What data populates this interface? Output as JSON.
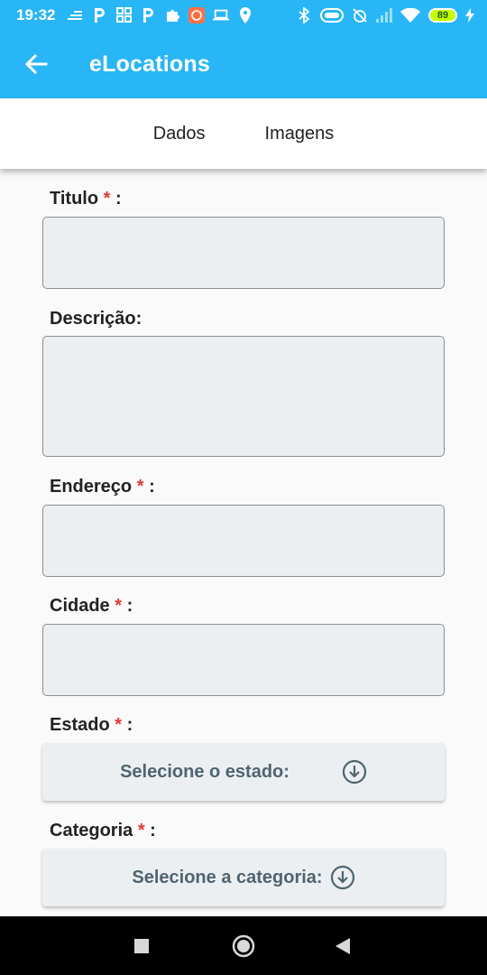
{
  "status_bar": {
    "time": "19:32",
    "battery_level": "89",
    "left_icons": [
      "data-traffic-icon",
      "parking-p-icon",
      "qr-grid-icon",
      "parking-p-icon",
      "puzzle-icon",
      "app-badge-icon",
      "laptop-icon",
      "location-pin-icon"
    ],
    "right_icons": [
      "bluetooth-icon",
      "toggle-icon",
      "alarm-off-icon",
      "signal-icon",
      "wifi-icon",
      "battery-icon",
      "charging-icon"
    ]
  },
  "app_bar": {
    "title": "eLocations",
    "back_icon": "arrow-left-icon",
    "color": "#29b6f6"
  },
  "tabs": [
    {
      "label": "Dados"
    },
    {
      "label": "Imagens"
    }
  ],
  "form": {
    "required_marker": "*",
    "separator": ":",
    "titulo": {
      "label": "Titulo",
      "required": true
    },
    "descricao": {
      "label": "Descrição:",
      "required": false
    },
    "endereco": {
      "label": "Endereço",
      "required": true
    },
    "cidade": {
      "label": "Cidade",
      "required": true
    },
    "estado": {
      "label": "Estado",
      "required": true,
      "placeholder": "Selecione o estado:"
    },
    "categoria": {
      "label": "Categoria",
      "required": true,
      "placeholder": "Selecione a categoria:"
    },
    "dropdown_icon": "circle-arrow-down-icon",
    "required_color": "#e53935"
  },
  "nav_bar": {
    "buttons": [
      "square-recents-icon",
      "circle-home-icon",
      "triangle-back-icon"
    ]
  }
}
